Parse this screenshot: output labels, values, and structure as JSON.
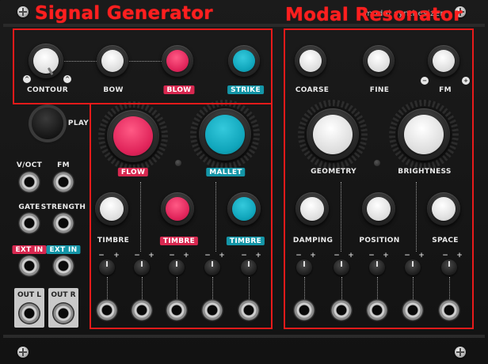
{
  "overlay": {
    "signal_title": "Signal Generator",
    "modal_title": "Modal Resonator"
  },
  "brand": "modal synthesizer",
  "signal": {
    "contour": "CONTOUR",
    "bow": "BOW",
    "blow": "BLOW",
    "strike": "STRIKE",
    "play": "PLAY",
    "flow": "FLOW",
    "mallet": "MALLET",
    "timbre_bow": "TIMBRE",
    "timbre_blow": "TIMBRE",
    "timbre_strike": "TIMBRE"
  },
  "modal": {
    "coarse": "COARSE",
    "fine": "FINE",
    "fm": "FM",
    "geometry": "GEOMETRY",
    "brightness": "BRIGHTNESS",
    "damping": "DAMPING",
    "position": "POSITION",
    "space": "SPACE"
  },
  "io": {
    "voct": "V/OCT",
    "fm": "FM",
    "gate": "GATE",
    "strength": "STRENGTH",
    "ext_in_1": "EXT IN",
    "ext_in_2": "EXT IN",
    "out_l": "OUT L",
    "out_r": "OUT R"
  },
  "trim": {
    "minus": "−",
    "plus": "+"
  },
  "colors": {
    "annotation": "#e81a1a",
    "red_accent": "#d82850",
    "teal_accent": "#1496a8"
  }
}
